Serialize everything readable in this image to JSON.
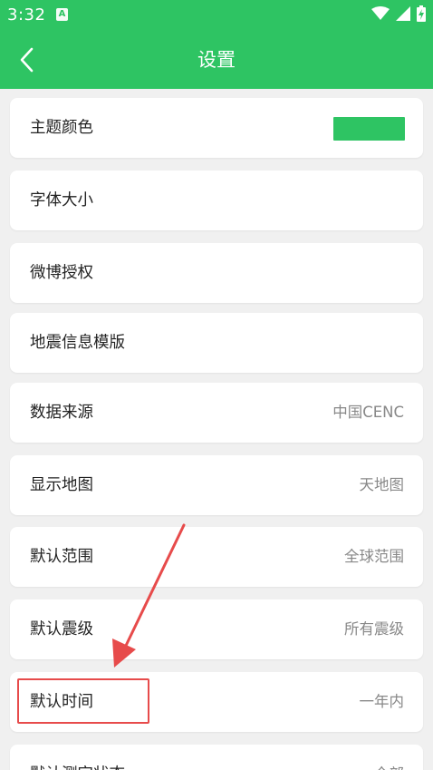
{
  "status_bar": {
    "time": "3:32",
    "app_badge": "A"
  },
  "toolbar": {
    "title": "设置"
  },
  "colors": {
    "brand": "#2ec463",
    "theme_swatch": "#2ec463",
    "annotation": "#e74b4b"
  },
  "settings": {
    "items": [
      {
        "label": "主题颜色",
        "value": ""
      },
      {
        "label": "字体大小",
        "value": ""
      },
      {
        "label": "微博授权",
        "value": ""
      },
      {
        "label": "地震信息模版",
        "value": ""
      },
      {
        "label": "数据来源",
        "value": "中国CENC"
      },
      {
        "label": "显示地图",
        "value": "天地图"
      },
      {
        "label": "默认范围",
        "value": "全球范围"
      },
      {
        "label": "默认震级",
        "value": "所有震级"
      },
      {
        "label": "默认时间",
        "value": "一年内"
      },
      {
        "label": "默认测定状态",
        "value": "全部"
      }
    ]
  }
}
